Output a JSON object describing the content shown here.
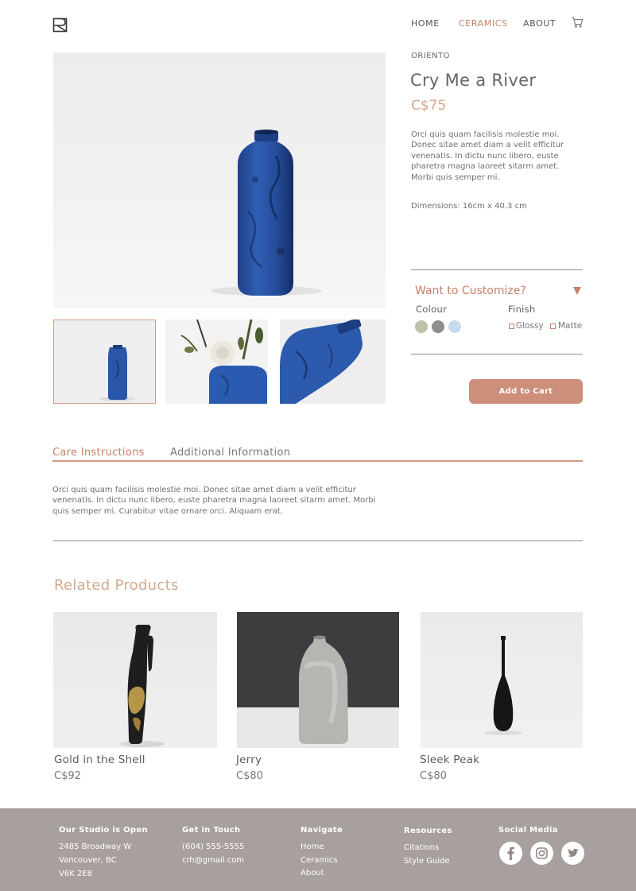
{
  "header": {
    "nav": [
      "HOME",
      "CERAMICS",
      "ABOUT"
    ]
  },
  "product": {
    "brand": "ORIENTO",
    "title": "Cry Me a River",
    "price": "C$75",
    "description": "Orci quis quam facilisis molestie moi. Donec sitae amet diam a velit efficitur venenatis. In dictu  nunc libero, euste pharetra magna laoreet sitarm amet. Morbi quis semper mi.",
    "dimensions": "Dimensions: 16cm x 40.3 cm"
  },
  "customize": {
    "heading": "Want to Customize?",
    "colour_label": "Colour",
    "finish_label": "Finish",
    "swatches": [
      "#bcc3a9",
      "#8f8f8f",
      "#c8dbea"
    ],
    "finishes": [
      "Glossy",
      "Matte"
    ],
    "add_to_cart": "Add to Cart"
  },
  "tabs": {
    "items": [
      "Care Instructions",
      "Additional Information"
    ],
    "content": "Orci quis quam facilisis molestie moi. Donec sitae amet diam a velit efficitur venenatis. In dictu  nunc libero, euste pharetra magna laoreet sitarm amet. Morbi quis semper mi. Curabitur vitae ornare orci. Aliquam erat."
  },
  "related": {
    "heading": "Related Products",
    "items": [
      {
        "name": "Gold in the Shell",
        "price": "C$92"
      },
      {
        "name": "Jerry",
        "price": "C$80"
      },
      {
        "name": "Sleek Peak",
        "price": "C$80"
      }
    ]
  },
  "footer": {
    "studio": {
      "heading": "Our Studio is Open",
      "lines": [
        "2485 Broadway W",
        "Vancouver, BC",
        "V6K 2E8"
      ]
    },
    "contact": {
      "heading": "Get in Touch",
      "lines": [
        "(604) 555-5555",
        "crh@gmail.com"
      ]
    },
    "navigate": {
      "heading": "Navigate",
      "links": [
        "Home",
        "Ceramics",
        "About"
      ]
    },
    "resources": {
      "heading": "Resources",
      "links": [
        "Citations",
        "Style Guide"
      ]
    },
    "social": {
      "heading": "Social Media",
      "icons": [
        "facebook-icon",
        "instagram-icon",
        "twitter-icon"
      ]
    }
  },
  "colors": {
    "accent": "#c8816a",
    "price": "#d3a98e",
    "button": "#cd8e7a",
    "footer_bg": "#a7a09e"
  }
}
